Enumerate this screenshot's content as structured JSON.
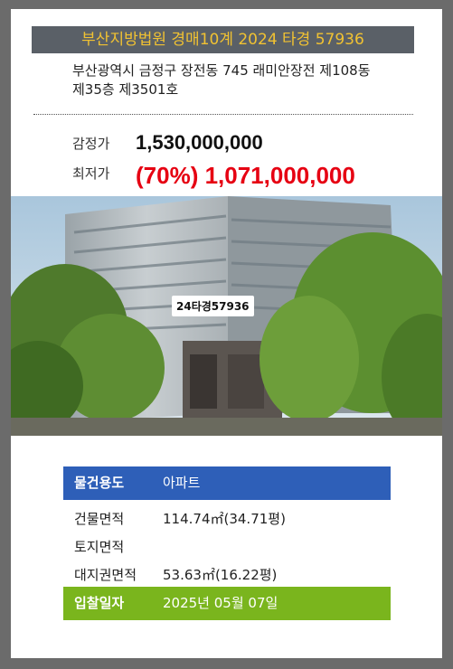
{
  "header": {
    "title": "부산지방법원 경매10계 2024 타경 57936"
  },
  "property": {
    "address_line1": "부산광역시 금정구 장전동 745 래미안장전 제108동",
    "address_line2": "제35층 제3501호"
  },
  "prices": {
    "appraisal_label": "감정가",
    "appraisal_value": "1,530,000,000",
    "minimum_label": "최저가",
    "minimum_value": "(70%) 1,071,000,000"
  },
  "photo": {
    "tag": "24타경57936"
  },
  "details": [
    {
      "label": "물건용도",
      "value": "아파트"
    },
    {
      "label": "건물면적",
      "value": "114.74㎡(34.71평)"
    },
    {
      "label": "토지면적",
      "value": ""
    },
    {
      "label": "대지권면적",
      "value": "53.63㎡(16.22평)"
    },
    {
      "label": "입찰일자",
      "value": "2025년 05월 07일"
    }
  ],
  "colors": {
    "header_bg": "#5a6067",
    "header_text": "#f1c232",
    "minimum_price": "#e60012",
    "usage_row": "#2e5fb8",
    "bid_date_row": "#7ab51d"
  }
}
